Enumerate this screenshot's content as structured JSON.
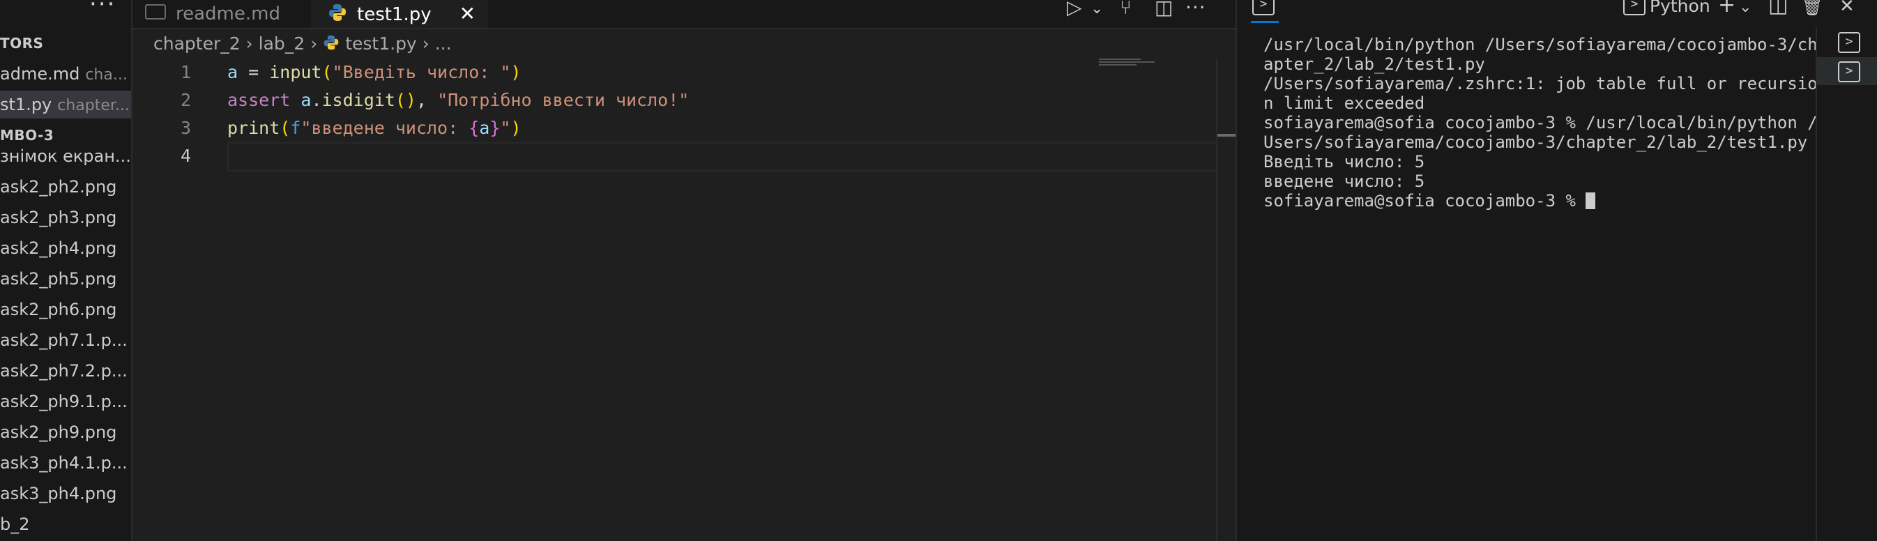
{
  "sidebar": {
    "more_label": "···",
    "open_editors_label": "TORS",
    "open_editors": [
      {
        "name": "adme.md",
        "desc": "cha..."
      },
      {
        "name": "st1.py",
        "desc": "chapter..."
      }
    ],
    "folder_label": "MBO-3",
    "files": [
      "знімок екран...",
      "ask2_ph2.png",
      "ask2_ph3.png",
      "ask2_ph4.png",
      "ask2_ph5.png",
      "ask2_ph6.png",
      "ask2_ph7.1.p...",
      "ask2_ph7.2.p...",
      "ask2_ph9.1.p...",
      "ask2_ph9.png",
      "ask3_ph4.1.p...",
      "ask3_ph4.png",
      "b_2"
    ]
  },
  "tabs": [
    {
      "label": "readme.md",
      "icon": "markdown-icon"
    },
    {
      "label": "test1.py",
      "icon": "python-icon",
      "close": "✕"
    }
  ],
  "editor_actions": {
    "run": "▷",
    "chevron": "⌄",
    "source": "⑂",
    "split": "◫",
    "more": "···"
  },
  "breadcrumb": {
    "folder1": "chapter_2",
    "sep": "›",
    "folder2": "lab_2",
    "file": "test1.py",
    "tail": "..."
  },
  "code": {
    "line_numbers": [
      "1",
      "2",
      "3",
      "4"
    ],
    "line1": {
      "var": "a",
      "op": " = ",
      "fn": "input",
      "open": "(",
      "str": "\"Введіть число: \"",
      "close": ")"
    },
    "line2": {
      "kw": "assert",
      "sp": " ",
      "obj": "a",
      "dot": ".",
      "fn": "isdigit",
      "parens": "()",
      "comma": ", ",
      "str": "\"Потрібно ввести число!\""
    },
    "line3": {
      "fn": "print",
      "open": "(",
      "fpre": "f",
      "str": "\"введене число: ",
      "lb": "{",
      "var": "a",
      "rb": "}",
      "strend": "\"",
      "close": ")"
    }
  },
  "terminal": {
    "header_label": "Python",
    "buttons": {
      "add": "+",
      "chevron": "⌄",
      "split": "◫",
      "trash": "🗑",
      "close": "✕"
    },
    "lines": [
      "/usr/local/bin/python /Users/sofiayarema/cocojambo-3/ch",
      "apter_2/lab_2/test1.py",
      "/Users/sofiayarema/.zshrc:1: job table full or recursio",
      "n limit exceeded",
      "sofiayarema@sofia cocojambo-3 % /usr/local/bin/python /",
      "Users/sofiayarema/cocojambo-3/chapter_2/lab_2/test1.py",
      "Введіть число: 5",
      "введене число: 5"
    ],
    "prompt": "sofiayarema@sofia cocojambo-3 % ",
    "icon_glyph": ">"
  }
}
